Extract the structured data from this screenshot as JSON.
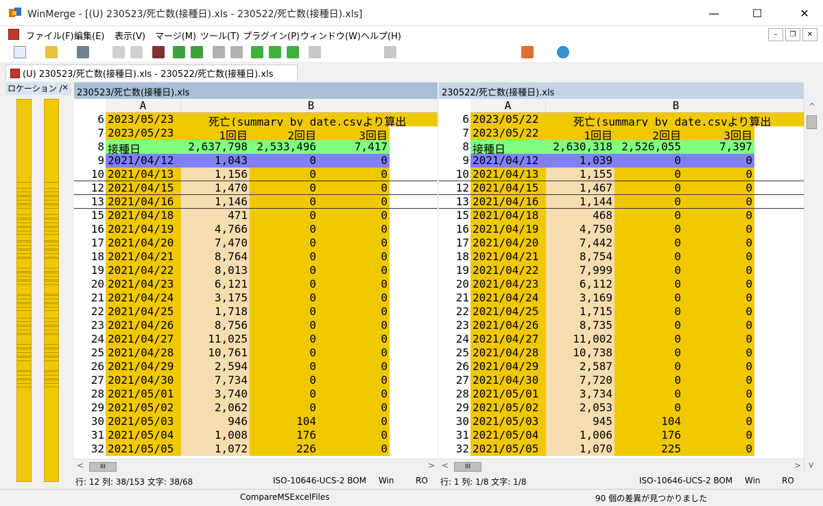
{
  "window": {
    "title": "WinMerge - [(U) 230523/死亡数(接種日).xls - 230522/死亡数(接種日).xls]",
    "min": "—",
    "max": "☐",
    "close": "✕"
  },
  "menu": [
    "ファイル(F)",
    "編集(E)",
    "表示(V)",
    "マージ(M)",
    "ツール(T)",
    "プラグイン(P)",
    "ウィンドウ(W)",
    "ヘルプ(H)"
  ],
  "mdi": {
    "min": "–",
    "restore": "❐",
    "close": "✕"
  },
  "tab": {
    "label": "(U) 230523/死亡数(接種日).xls - 230522/死亡数(接種日).xls"
  },
  "location_pane": {
    "title": "ロケーション /",
    "close": "×"
  },
  "left": {
    "file": "230523/死亡数(接種日).xls",
    "col_a": "A",
    "col_b": "B",
    "header_rows": [
      {
        "n": "6",
        "date": "2023/05/23",
        "text": "死亡(summary_by_date.csvより算出"
      },
      {
        "n": "7",
        "date": "2023/05/23",
        "v1": "1回目",
        "v2": "2回目",
        "v3": "3回目"
      },
      {
        "n": "8",
        "date": "接種日",
        "v1": "2,637,798",
        "v2": "2,533,496",
        "v3": "7,417"
      },
      {
        "n": "9",
        "date": "2021/04/12",
        "v1": "1,043",
        "v2": "0",
        "v3": "0"
      }
    ],
    "rows": [
      {
        "n": "10",
        "date": "2021/04/13",
        "v1": "1,156",
        "v2": "0",
        "v3": "0"
      },
      {
        "n": "12",
        "date": "2021/04/15",
        "v1": "1,470",
        "v2": "0",
        "v3": "0"
      },
      {
        "n": "13",
        "date": "2021/04/16",
        "v1": "1,146",
        "v2": "0",
        "v3": "0"
      },
      {
        "n": "15",
        "date": "2021/04/18",
        "v1": "471",
        "v2": "0",
        "v3": "0"
      },
      {
        "n": "16",
        "date": "2021/04/19",
        "v1": "4,766",
        "v2": "0",
        "v3": "0"
      },
      {
        "n": "17",
        "date": "2021/04/20",
        "v1": "7,470",
        "v2": "0",
        "v3": "0"
      },
      {
        "n": "18",
        "date": "2021/04/21",
        "v1": "8,764",
        "v2": "0",
        "v3": "0"
      },
      {
        "n": "19",
        "date": "2021/04/22",
        "v1": "8,013",
        "v2": "0",
        "v3": "0"
      },
      {
        "n": "20",
        "date": "2021/04/23",
        "v1": "6,121",
        "v2": "0",
        "v3": "0"
      },
      {
        "n": "21",
        "date": "2021/04/24",
        "v1": "3,175",
        "v2": "0",
        "v3": "0"
      },
      {
        "n": "22",
        "date": "2021/04/25",
        "v1": "1,718",
        "v2": "0",
        "v3": "0"
      },
      {
        "n": "23",
        "date": "2021/04/26",
        "v1": "8,756",
        "v2": "0",
        "v3": "0"
      },
      {
        "n": "24",
        "date": "2021/04/27",
        "v1": "11,025",
        "v2": "0",
        "v3": "0"
      },
      {
        "n": "25",
        "date": "2021/04/28",
        "v1": "10,761",
        "v2": "0",
        "v3": "0"
      },
      {
        "n": "26",
        "date": "2021/04/29",
        "v1": "2,594",
        "v2": "0",
        "v3": "0"
      },
      {
        "n": "27",
        "date": "2021/04/30",
        "v1": "7,734",
        "v2": "0",
        "v3": "0"
      },
      {
        "n": "28",
        "date": "2021/05/01",
        "v1": "3,740",
        "v2": "0",
        "v3": "0"
      },
      {
        "n": "29",
        "date": "2021/05/02",
        "v1": "2,062",
        "v2": "0",
        "v3": "0"
      },
      {
        "n": "30",
        "date": "2021/05/03",
        "v1": "946",
        "v2": "104",
        "v3": "0"
      },
      {
        "n": "31",
        "date": "2021/05/04",
        "v1": "1,008",
        "v2": "176",
        "v3": "0"
      },
      {
        "n": "32",
        "date": "2021/05/05",
        "v1": "1,072",
        "v2": "226",
        "v3": "0"
      }
    ],
    "status": {
      "pos": "行: 12  列: 38/153  文字: 38/68",
      "enc": "ISO-10646-UCS-2 BOM",
      "eol": "Win",
      "ro": "RO"
    }
  },
  "right": {
    "file": "230522/死亡数(接種日).xls",
    "col_a": "A",
    "col_b": "B",
    "header_rows": [
      {
        "n": "6",
        "date": "2023/05/22",
        "text": "死亡(summary_by_date.csvより算出"
      },
      {
        "n": "7",
        "date": "2023/05/22",
        "v1": "1回目",
        "v2": "2回目",
        "v3": "3回目"
      },
      {
        "n": "8",
        "date": "接種日",
        "v1": "2,630,318",
        "v2": "2,526,055",
        "v3": "7,397"
      },
      {
        "n": "9",
        "date": "2021/04/12",
        "v1": "1,039",
        "v2": "0",
        "v3": "0"
      }
    ],
    "rows": [
      {
        "n": "10",
        "date": "2021/04/13",
        "v1": "1,155",
        "v2": "0",
        "v3": "0"
      },
      {
        "n": "12",
        "date": "2021/04/15",
        "v1": "1,467",
        "v2": "0",
        "v3": "0"
      },
      {
        "n": "13",
        "date": "2021/04/16",
        "v1": "1,144",
        "v2": "0",
        "v3": "0"
      },
      {
        "n": "15",
        "date": "2021/04/18",
        "v1": "468",
        "v2": "0",
        "v3": "0"
      },
      {
        "n": "16",
        "date": "2021/04/19",
        "v1": "4,750",
        "v2": "0",
        "v3": "0"
      },
      {
        "n": "17",
        "date": "2021/04/20",
        "v1": "7,442",
        "v2": "0",
        "v3": "0"
      },
      {
        "n": "18",
        "date": "2021/04/21",
        "v1": "8,754",
        "v2": "0",
        "v3": "0"
      },
      {
        "n": "19",
        "date": "2021/04/22",
        "v1": "7,999",
        "v2": "0",
        "v3": "0"
      },
      {
        "n": "20",
        "date": "2021/04/23",
        "v1": "6,112",
        "v2": "0",
        "v3": "0"
      },
      {
        "n": "21",
        "date": "2021/04/24",
        "v1": "3,169",
        "v2": "0",
        "v3": "0"
      },
      {
        "n": "22",
        "date": "2021/04/25",
        "v1": "1,715",
        "v2": "0",
        "v3": "0"
      },
      {
        "n": "23",
        "date": "2021/04/26",
        "v1": "8,735",
        "v2": "0",
        "v3": "0"
      },
      {
        "n": "24",
        "date": "2021/04/27",
        "v1": "11,002",
        "v2": "0",
        "v3": "0"
      },
      {
        "n": "25",
        "date": "2021/04/28",
        "v1": "10,738",
        "v2": "0",
        "v3": "0"
      },
      {
        "n": "26",
        "date": "2021/04/29",
        "v1": "2,587",
        "v2": "0",
        "v3": "0"
      },
      {
        "n": "27",
        "date": "2021/04/30",
        "v1": "7,720",
        "v2": "0",
        "v3": "0"
      },
      {
        "n": "28",
        "date": "2021/05/01",
        "v1": "3,734",
        "v2": "0",
        "v3": "0"
      },
      {
        "n": "29",
        "date": "2021/05/02",
        "v1": "2,053",
        "v2": "0",
        "v3": "0"
      },
      {
        "n": "30",
        "date": "2021/05/03",
        "v1": "945",
        "v2": "104",
        "v3": "0"
      },
      {
        "n": "31",
        "date": "2021/05/04",
        "v1": "1,006",
        "v2": "176",
        "v3": "0"
      },
      {
        "n": "32",
        "date": "2021/05/05",
        "v1": "1,070",
        "v2": "225",
        "v3": "0"
      }
    ],
    "status": {
      "pos": "行: 1  列: 1/8  文字: 1/8",
      "enc": "ISO-10646-UCS-2 BOM",
      "eol": "Win",
      "ro": "RO"
    }
  },
  "statusbar": {
    "plugin": "CompareMSExcelFiles",
    "diffs": "90 個の差異が見つかりました"
  },
  "toolbar_icons": [
    "new-icon",
    "open-icon",
    "save-icon",
    "undo-icon",
    "redo-icon",
    "filmstrip-icon",
    "next-diff-icon",
    "prev-diff-icon",
    "first-diff-icon",
    "last-diff-icon",
    "current-diff-icon",
    "copy-right-icon",
    "copy-left-icon",
    "copy-all-icon",
    "merge-icon",
    "options-icon",
    "refresh-icon"
  ],
  "colors": {
    "changed": "#f0c800",
    "header_green": "#80ff80",
    "selected_blue": "#8080ff",
    "window_bg": "#f0f0f0"
  }
}
